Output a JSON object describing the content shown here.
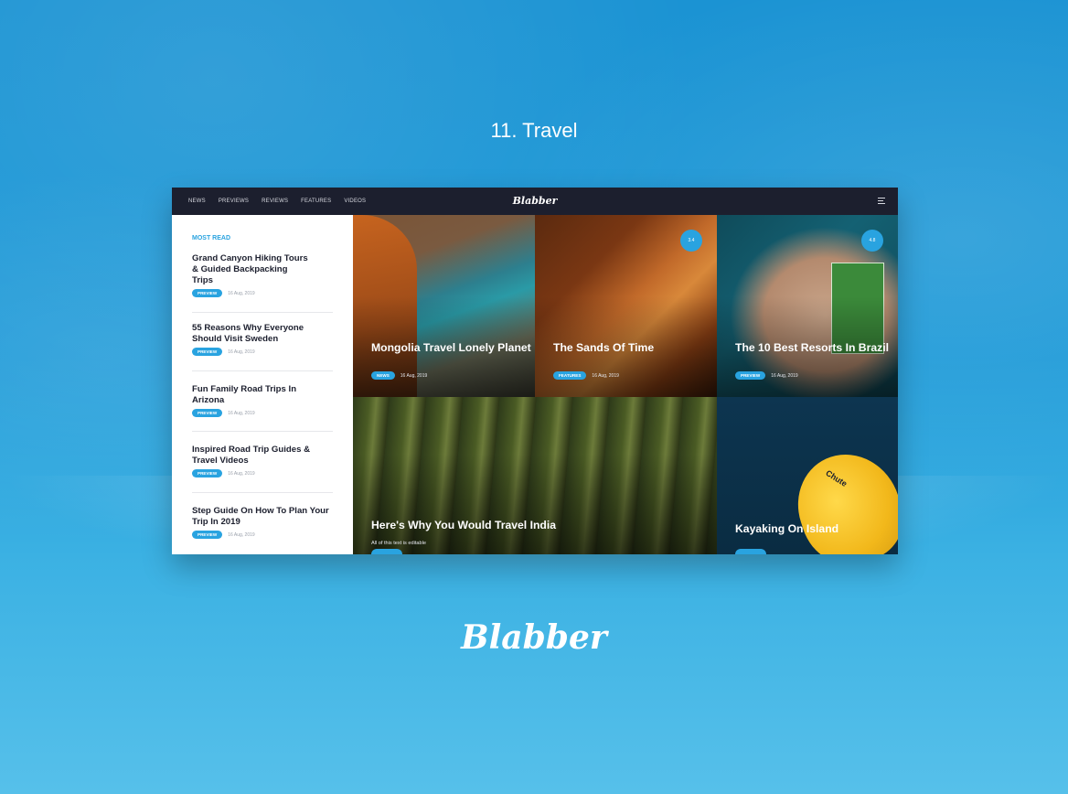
{
  "headline": "11. Travel",
  "nav": {
    "links": [
      "NEWS",
      "PREVIEWS",
      "REVIEWS",
      "FEATURES",
      "VIDEOS"
    ],
    "logo": "Blabber",
    "menu_icon": "hamburger-menu-icon"
  },
  "sidebar": {
    "heading": "MOST READ",
    "items": [
      {
        "title": "Grand Canyon Hiking Tours & Guided Backpacking Trips",
        "tag": "PREVIEW",
        "date": "16 Aug, 2019"
      },
      {
        "title": "55 Reasons Why Everyone Should Visit Sweden",
        "tag": "PREVIEW",
        "date": "16 Aug, 2019"
      },
      {
        "title": "Fun Family Road Trips In Arizona",
        "tag": "PREVIEW",
        "date": "16 Aug, 2019"
      },
      {
        "title": "Inspired Road Trip Guides & Travel Videos",
        "tag": "PREVIEW",
        "date": "16 Aug, 2019"
      },
      {
        "title": "Step Guide On How To Plan Your Trip In 2019",
        "tag": "PREVIEW",
        "date": "16 Aug, 2019"
      }
    ]
  },
  "tiles": [
    {
      "title": "Mongolia Travel Lonely Planet",
      "tag": "NEWS",
      "date": "16 Aug, 2019"
    },
    {
      "title": "The Sands Of Time",
      "tag": "FEATURES",
      "date": "16 Aug, 2019",
      "score": "3.4"
    },
    {
      "title": "The 10 Best Resorts In Brazil",
      "tag": "PREVIEW",
      "date": "16 Aug, 2019",
      "score": "4.8"
    },
    {
      "title": "Here's Why You Would Travel India",
      "excerpt": "All of this text is editable"
    },
    {
      "title": "Kayaking On Island",
      "kayak_text": "Chute"
    }
  ],
  "footer_logo": "Blabber",
  "colors": {
    "accent": "#29a3e0",
    "nav_bg": "#1c1f2e",
    "ocean": "#1e9ad8"
  }
}
